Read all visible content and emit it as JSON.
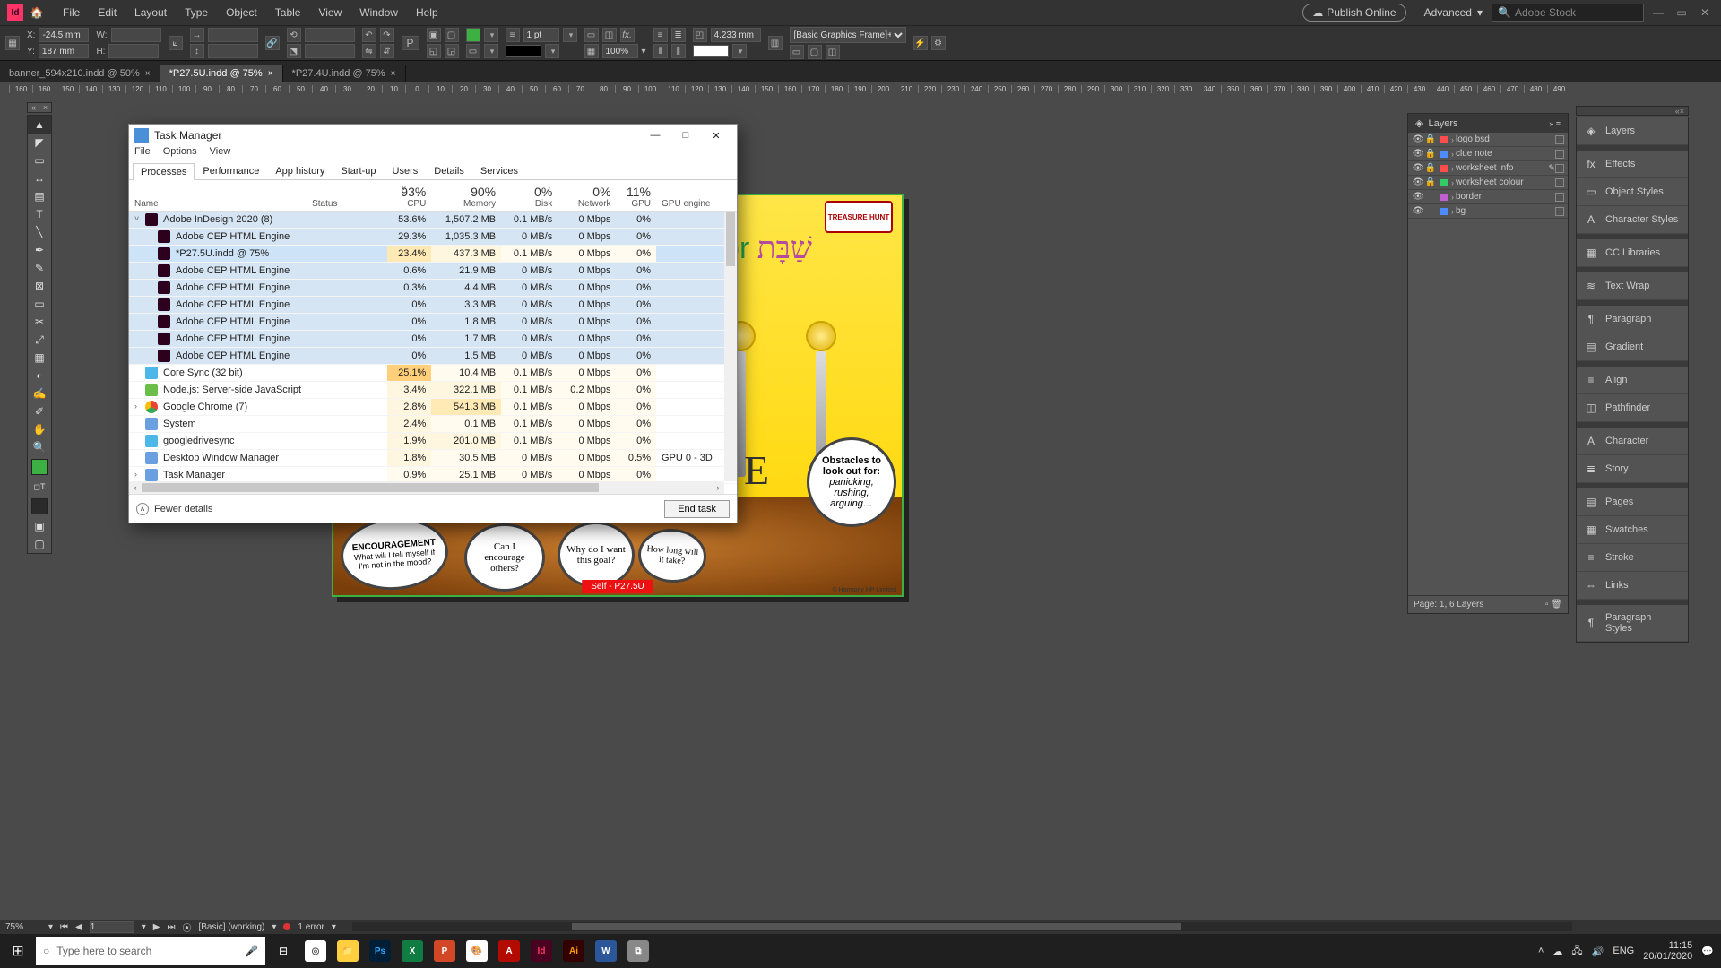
{
  "indesign": {
    "menu": [
      "File",
      "Edit",
      "Layout",
      "Type",
      "Object",
      "Table",
      "View",
      "Window",
      "Help"
    ],
    "publish": "Publish Online",
    "workspace": "Advanced",
    "search_placeholder": "Adobe Stock",
    "control": {
      "x_label": "X:",
      "x": "-24.5 mm",
      "y_label": "Y:",
      "y": "187 mm",
      "w_label": "W:",
      "w": "",
      "h_label": "H:",
      "h": "",
      "stroke_pt": "1 pt",
      "opacity": "100%",
      "corner": "4.233 mm",
      "style": "[Basic Graphics Frame]+"
    },
    "tabs": [
      {
        "label": "banner_594x210.indd @ 50%",
        "active": false
      },
      {
        "label": "*P27.5U.indd @ 75%",
        "active": true
      },
      {
        "label": "*P27.4U.indd @ 75%",
        "active": false
      }
    ],
    "ruler": [
      "160",
      "160",
      "150",
      "140",
      "130",
      "120",
      "110",
      "100",
      "90",
      "80",
      "70",
      "60",
      "50",
      "40",
      "30",
      "20",
      "10",
      "0",
      "10",
      "20",
      "30",
      "40",
      "50",
      "60",
      "70",
      "80",
      "90",
      "100",
      "110",
      "120",
      "130",
      "140",
      "150",
      "160",
      "170",
      "180",
      "190",
      "200",
      "210",
      "220",
      "230",
      "240",
      "250",
      "260",
      "270",
      "280",
      "290",
      "300",
      "310",
      "320",
      "330",
      "340",
      "350",
      "360",
      "370",
      "380",
      "390",
      "400",
      "410",
      "420",
      "430",
      "440",
      "450",
      "460",
      "470",
      "480",
      "490"
    ],
    "layers_title": "Layers",
    "layers": [
      {
        "name": "logo bsd",
        "color": "#ff4d4d",
        "locked": true
      },
      {
        "name": "clue note",
        "color": "#4d8bff",
        "locked": true
      },
      {
        "name": "worksheet info",
        "color": "#ff4d4d",
        "locked": true,
        "pencil": true
      },
      {
        "name": "worksheet colour",
        "color": "#33cc66",
        "locked": true
      },
      {
        "name": "border",
        "color": "#c060d0",
        "locked": false
      },
      {
        "name": "bg",
        "color": "#4d8bff",
        "locked": false
      }
    ],
    "layers_footer": "Page: 1, 6 Layers",
    "right_panels": [
      "Layers",
      "Effects",
      "Object Styles",
      "Character Styles",
      "CC Libraries",
      "Text Wrap",
      "Paragraph",
      "Gradient",
      "Align",
      "Pathfinder",
      "Character",
      "Story",
      "Pages",
      "Swatches",
      "Stroke",
      "Links",
      "Paragraph Styles"
    ],
    "right_icons": [
      "◈",
      "fx",
      "▭",
      "A",
      "▦",
      "≋",
      "¶",
      "▤",
      "≡",
      "◫",
      "A",
      "≣",
      "▤",
      "▦",
      "≡",
      "⇔",
      "¶"
    ],
    "status": {
      "zoom": "75%",
      "page": "1",
      "profile": "[Basic] (working)",
      "errors": "1 error"
    }
  },
  "canvas": {
    "logo": "TREASURE HUNT",
    "title_for": "for",
    "title_heb": "שַׁבָּת",
    "big_e": "E",
    "bubble_obstacles_head": "Obstacles to look out for:",
    "bubble_obstacles_body": "panicking, rushing, arguing…",
    "bubble_enc_head": "ENCOURAGEMENT",
    "bubble_enc_body": "What will I tell myself if I'm not in the mood?",
    "bubble_can": "Can I encourage others?",
    "bubble_why": "Why do I want this goal?",
    "bubble_how": "How long will it take?",
    "self_label": "Self - P27.5U",
    "copyright": "© Harmony HP Limited"
  },
  "taskmgr": {
    "title": "Task Manager",
    "menu": [
      "File",
      "Options",
      "View"
    ],
    "tabs": [
      "Processes",
      "Performance",
      "App history",
      "Start-up",
      "Users",
      "Details",
      "Services"
    ],
    "active_tab": 0,
    "cols": {
      "name": "Name",
      "status": "Status",
      "cpu_pct": "93%",
      "cpu": "CPU",
      "mem_pct": "90%",
      "mem": "Memory",
      "disk_pct": "0%",
      "disk": "Disk",
      "net_pct": "0%",
      "net": "Network",
      "gpu_pct": "11%",
      "gpu": "GPU",
      "gpu_eng": "GPU engine"
    },
    "rows": [
      {
        "expand": "˅",
        "icon": "#2d001e",
        "name": "Adobe InDesign 2020 (8)",
        "cpu": "53.6%",
        "mem": "1,507.2 MB",
        "disk": "0.1 MB/s",
        "net": "0 Mbps",
        "gpu": "0%",
        "eng": "",
        "hl": true,
        "cpu_heat": "hi",
        "mem_heat": "md"
      },
      {
        "expand": "",
        "icon": "#2d001e",
        "name": "Adobe CEP HTML Engine",
        "cpu": "29.3%",
        "mem": "1,035.3 MB",
        "disk": "0 MB/s",
        "net": "0 Mbps",
        "gpu": "0%",
        "eng": "",
        "hl": true,
        "cpu_heat": "md",
        "mem_heat": "md",
        "indent": true
      },
      {
        "expand": "",
        "icon": "#2d001e",
        "name": "*P27.5U.indd @ 75%",
        "cpu": "23.4%",
        "mem": "437.3 MB",
        "disk": "0.1 MB/s",
        "net": "0 Mbps",
        "gpu": "0%",
        "eng": "",
        "sel": true,
        "cpu_heat": "md",
        "mem_heat": "lo",
        "indent": true
      },
      {
        "expand": "",
        "icon": "#2d001e",
        "name": "Adobe CEP HTML Engine",
        "cpu": "0.6%",
        "mem": "21.9 MB",
        "disk": "0 MB/s",
        "net": "0 Mbps",
        "gpu": "0%",
        "eng": "",
        "hl": true,
        "cpu_heat": "vlo",
        "mem_heat": "vlo",
        "indent": true
      },
      {
        "expand": "",
        "icon": "#2d001e",
        "name": "Adobe CEP HTML Engine",
        "cpu": "0.3%",
        "mem": "4.4 MB",
        "disk": "0 MB/s",
        "net": "0 Mbps",
        "gpu": "0%",
        "eng": "",
        "hl": true,
        "cpu_heat": "vlo",
        "mem_heat": "vlo",
        "indent": true
      },
      {
        "expand": "",
        "icon": "#2d001e",
        "name": "Adobe CEP HTML Engine",
        "cpu": "0%",
        "mem": "3.3 MB",
        "disk": "0 MB/s",
        "net": "0 Mbps",
        "gpu": "0%",
        "eng": "",
        "hl": true,
        "cpu_heat": "vlo",
        "mem_heat": "vlo",
        "indent": true
      },
      {
        "expand": "",
        "icon": "#2d001e",
        "name": "Adobe CEP HTML Engine",
        "cpu": "0%",
        "mem": "1.8 MB",
        "disk": "0 MB/s",
        "net": "0 Mbps",
        "gpu": "0%",
        "eng": "",
        "hl": true,
        "cpu_heat": "vlo",
        "mem_heat": "vlo",
        "indent": true
      },
      {
        "expand": "",
        "icon": "#2d001e",
        "name": "Adobe CEP HTML Engine",
        "cpu": "0%",
        "mem": "1.7 MB",
        "disk": "0 MB/s",
        "net": "0 Mbps",
        "gpu": "0%",
        "eng": "",
        "hl": true,
        "cpu_heat": "vlo",
        "mem_heat": "vlo",
        "indent": true
      },
      {
        "expand": "",
        "icon": "#2d001e",
        "name": "Adobe CEP HTML Engine",
        "cpu": "0%",
        "mem": "1.5 MB",
        "disk": "0 MB/s",
        "net": "0 Mbps",
        "gpu": "0%",
        "eng": "",
        "hl": true,
        "cpu_heat": "vlo",
        "mem_heat": "vlo",
        "indent": true
      },
      {
        "expand": "",
        "icon": "#4db8e8",
        "name": "Core Sync (32 bit)",
        "cpu": "25.1%",
        "mem": "10.4 MB",
        "disk": "0.1 MB/s",
        "net": "0 Mbps",
        "gpu": "0%",
        "eng": "",
        "cpu_heat": "hi",
        "mem_heat": "vlo"
      },
      {
        "expand": "",
        "icon": "#6abf4b",
        "name": "Node.js: Server-side JavaScript",
        "cpu": "3.4%",
        "mem": "322.1 MB",
        "disk": "0.1 MB/s",
        "net": "0.2 Mbps",
        "gpu": "0%",
        "eng": "",
        "cpu_heat": "lo",
        "mem_heat": "lo"
      },
      {
        "expand": "›",
        "icon": "#ffffff",
        "name": "Google Chrome (7)",
        "cpu": "2.8%",
        "mem": "541.3 MB",
        "disk": "0.1 MB/s",
        "net": "0 Mbps",
        "gpu": "0%",
        "eng": "",
        "cpu_heat": "lo",
        "mem_heat": "md",
        "chrome": true
      },
      {
        "expand": "",
        "icon": "#6aa0e0",
        "name": "System",
        "cpu": "2.4%",
        "mem": "0.1 MB",
        "disk": "0.1 MB/s",
        "net": "0 Mbps",
        "gpu": "0%",
        "eng": "",
        "cpu_heat": "lo",
        "mem_heat": "vlo"
      },
      {
        "expand": "",
        "icon": "#4db8e8",
        "name": "googledrivesync",
        "cpu": "1.9%",
        "mem": "201.0 MB",
        "disk": "0.1 MB/s",
        "net": "0 Mbps",
        "gpu": "0%",
        "eng": "",
        "cpu_heat": "lo",
        "mem_heat": "lo"
      },
      {
        "expand": "",
        "icon": "#6aa0e0",
        "name": "Desktop Window Manager",
        "cpu": "1.8%",
        "mem": "30.5 MB",
        "disk": "0 MB/s",
        "net": "0 Mbps",
        "gpu": "0.5%",
        "eng": "GPU 0 - 3D",
        "cpu_heat": "lo",
        "mem_heat": "vlo"
      },
      {
        "expand": "›",
        "icon": "#6aa0e0",
        "name": "Task Manager",
        "cpu": "0.9%",
        "mem": "25.1 MB",
        "disk": "0 MB/s",
        "net": "0 Mbps",
        "gpu": "0%",
        "eng": "",
        "cpu_heat": "vlo",
        "mem_heat": "vlo"
      }
    ],
    "fewer": "Fewer details",
    "end_task": "End task"
  },
  "taskbar": {
    "search_placeholder": "Type here to search",
    "apps": [
      {
        "bg": "#fff",
        "fg": "#555",
        "tx": "◎",
        "title": "chrome"
      },
      {
        "bg": "#ffcf3f",
        "fg": "#7a5200",
        "tx": "📁",
        "title": "explorer"
      },
      {
        "bg": "#001e36",
        "fg": "#31a8ff",
        "tx": "Ps",
        "title": "photoshop"
      },
      {
        "bg": "#107c41",
        "fg": "#fff",
        "tx": "X",
        "title": "excel"
      },
      {
        "bg": "#d24726",
        "fg": "#fff",
        "tx": "P",
        "title": "powerpoint"
      },
      {
        "bg": "#fff",
        "fg": "#d24",
        "tx": "🎨",
        "title": "snip"
      },
      {
        "bg": "#b30b00",
        "fg": "#fff",
        "tx": "A",
        "title": "acrobat"
      },
      {
        "bg": "#49021f",
        "fg": "#ff3366",
        "tx": "Id",
        "title": "indesign"
      },
      {
        "bg": "#330000",
        "fg": "#ff9a00",
        "tx": "Ai",
        "title": "illustrator"
      },
      {
        "bg": "#2b579a",
        "fg": "#fff",
        "tx": "W",
        "title": "word"
      },
      {
        "bg": "#888",
        "fg": "#fff",
        "tx": "⧉",
        "title": "other"
      }
    ],
    "lang": "ENG",
    "vol": "🔊",
    "time": "11:15",
    "date": "20/01/2020"
  }
}
